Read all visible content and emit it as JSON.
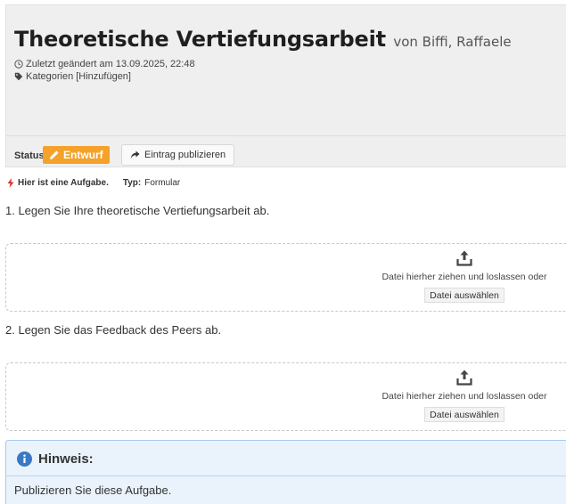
{
  "entry": {
    "title": "Theoretische Vertiefungsarbeit",
    "author": "von Biffi, Raffaele",
    "updated": "Zuletzt geändert am 13.09.2025, 22:48",
    "categories_label": "Kategorien",
    "categories_add": "[Hinzufügen]"
  },
  "status": {
    "label": "Status:",
    "badge": "Entwurf",
    "publish_button": "Eintrag publizieren"
  },
  "task": {
    "notice": "Hier ist eine Aufgabe.",
    "type_label": "Typ:",
    "type_value": "Formular"
  },
  "steps": [
    {
      "label": "1. Legen Sie Ihre theoretische Vertiefungsarbeit ab.",
      "drop_text": "Datei hierher ziehen und loslassen oder",
      "choose_button": "Datei auswählen"
    },
    {
      "label": "2. Legen Sie das Feedback des Peers ab.",
      "drop_text": "Datei hierher ziehen und loslassen oder",
      "choose_button": "Datei auswählen"
    }
  ],
  "hint": {
    "title": "Hinweis:",
    "text": "Publizieren Sie diese Aufgabe."
  },
  "colors": {
    "draft_badge": "#f4a229",
    "hint_background": "#eaf3fc",
    "info_icon": "#3a78c3",
    "task_bolt": "#d9342b"
  },
  "icons": {
    "updated": "clock-icon",
    "categories": "tag-icon",
    "draft": "pencil-icon",
    "publish": "share-arrow-icon",
    "task": "bolt-icon",
    "upload": "upload-icon",
    "hint": "info-icon"
  }
}
